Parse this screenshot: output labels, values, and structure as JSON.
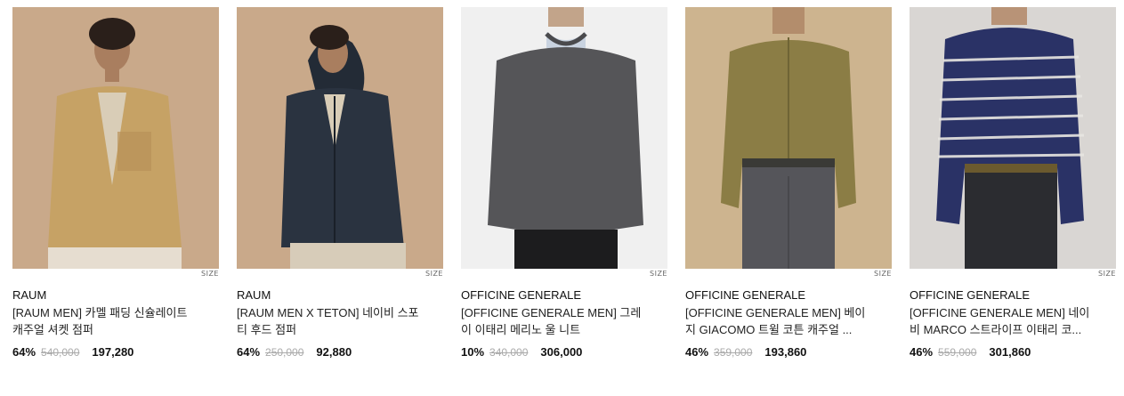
{
  "products": [
    {
      "brand": "RAUM",
      "name": "[RAUM MEN] 카멜 패딩 신슐레이트 캐주얼 셔켓 점퍼",
      "discount": "64%",
      "original_price": "540,000",
      "sale_price": "197,280",
      "size_label": "SIZE",
      "bg_color": "#c9a98a",
      "garment_color": "#c6a265"
    },
    {
      "brand": "RAUM",
      "name": "[RAUM MEN X TETON] 네이비 스포티 후드 점퍼",
      "discount": "64%",
      "original_price": "250,000",
      "sale_price": "92,880",
      "size_label": "SIZE",
      "bg_color": "#c9a98a",
      "garment_color": "#2a3340"
    },
    {
      "brand": "OFFICINE GENERALE",
      "name": "[OFFICINE GENERALE MEN] 그레이 이태리 메리노 울 니트",
      "discount": "10%",
      "original_price": "340,000",
      "sale_price": "306,000",
      "size_label": "SIZE",
      "bg_color": "#f0f0f0",
      "garment_color": "#555558"
    },
    {
      "brand": "OFFICINE GENERALE",
      "name": "[OFFICINE GENERALE MEN] 베이지 GIACOMO 트윌 코튼 캐주얼 ...",
      "discount": "46%",
      "original_price": "359,000",
      "sale_price": "193,860",
      "size_label": "SIZE",
      "bg_color": "#cdb48f",
      "garment_color": "#8b7d45"
    },
    {
      "brand": "OFFICINE GENERALE",
      "name": "[OFFICINE GENERALE MEN] 네이비 MARCO 스트라이프 이태리 코...",
      "discount": "46%",
      "original_price": "559,000",
      "sale_price": "301,860",
      "size_label": "SIZE",
      "bg_color": "#d9d6d3",
      "garment_color": "#2a3266"
    }
  ]
}
